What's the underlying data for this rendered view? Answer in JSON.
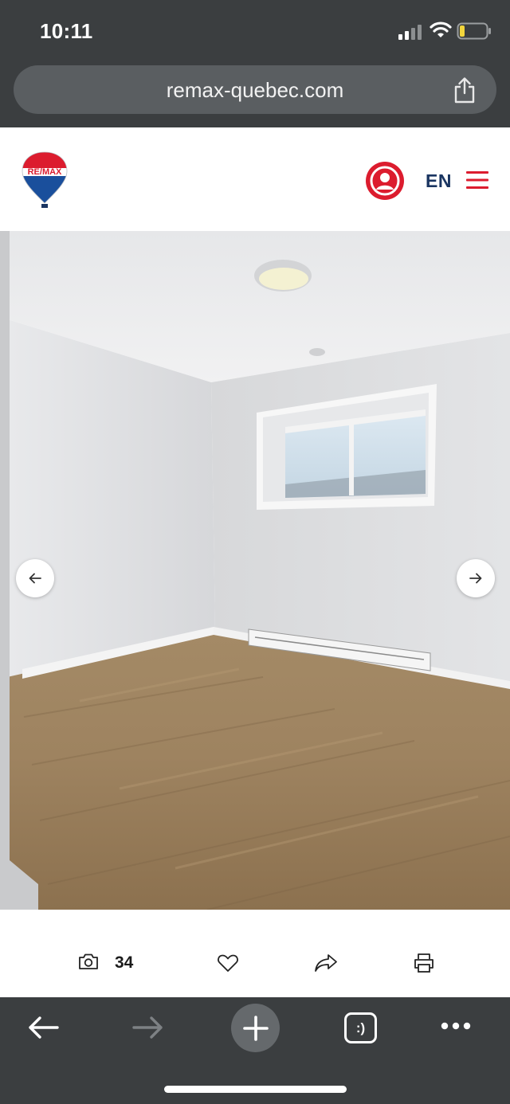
{
  "status_bar": {
    "time": "10:11"
  },
  "browser": {
    "url": "remax-quebec.com",
    "tabs_label": ":)"
  },
  "site_header": {
    "logo_text": "RE/MAX",
    "language": "EN"
  },
  "gallery": {
    "photo_count": "34",
    "photo_subject": "empty bedroom with laminate floor, window and baseboard heater"
  },
  "colors": {
    "brand_red": "#dc1c2e",
    "brand_blue": "#1a3561",
    "chrome_dark": "#3b3e40"
  },
  "icons": {
    "share": "share-icon",
    "user": "user-icon",
    "menu": "hamburger-menu-icon",
    "prev": "arrow-left-icon",
    "next": "arrow-right-icon",
    "camera": "camera-icon",
    "favorite": "heart-icon",
    "share_listing": "share-arrow-icon",
    "print": "printer-icon"
  }
}
